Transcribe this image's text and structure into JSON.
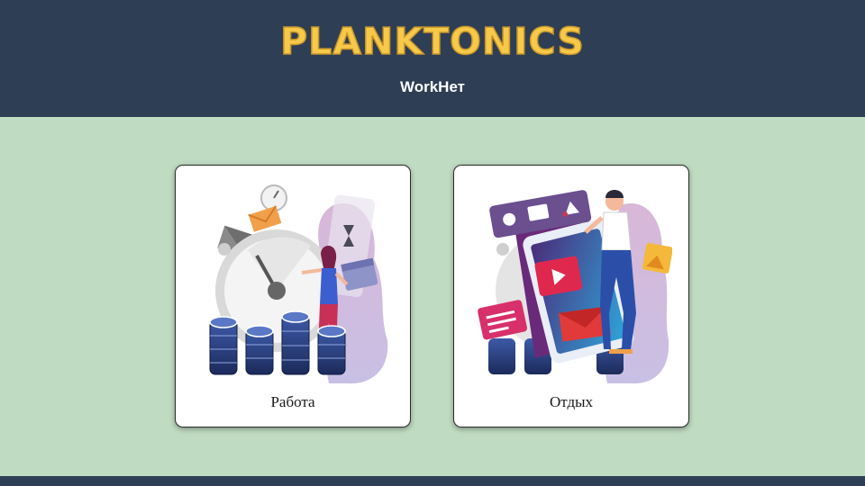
{
  "header": {
    "logo": "PLANKTONICS",
    "subtitle": "WorkНет"
  },
  "cards": [
    {
      "label": "Работа",
      "illustration": "work-illustration"
    },
    {
      "label": "Отдых",
      "illustration": "leisure-illustration"
    }
  ],
  "colors": {
    "header_bg": "#2e3e54",
    "page_bg": "#bfdbc1",
    "logo": "#f7c949",
    "card_bg": "#ffffff"
  }
}
